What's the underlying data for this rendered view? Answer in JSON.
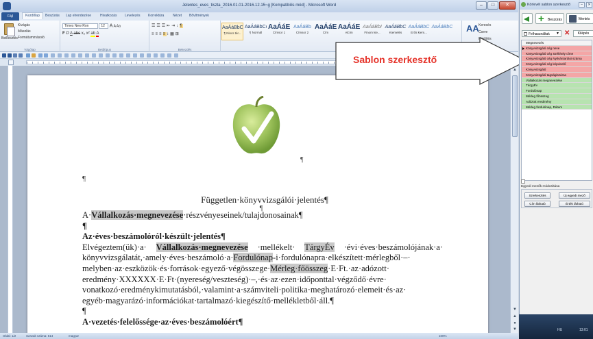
{
  "word": {
    "title": "Jelentes_eves_tiszta_2016.01.01-2016.12.15~g [Kompatibilis mód] - Microsoft Word",
    "tabs": [
      {
        "label": "Fájl"
      },
      {
        "label": "Kezdőlap"
      },
      {
        "label": "Beszúrás"
      },
      {
        "label": "Lap elrendezése"
      },
      {
        "label": "Hivatkozás"
      },
      {
        "label": "Levelezés"
      },
      {
        "label": "Korrektúra"
      },
      {
        "label": "Nézet"
      },
      {
        "label": "Bővítmények"
      }
    ],
    "clipboard": {
      "paste": "Beillesztés",
      "cut": "Kivágás",
      "copy": "Másolás",
      "format_painter": "Formátummásoló",
      "group": "Vágólap"
    },
    "font": {
      "name": "Times New Ron",
      "size": "12",
      "group": "Betűtípus"
    },
    "paragraph": {
      "group": "Bekezdés"
    },
    "styles": [
      {
        "sample": "AaÁáBbC",
        "name": "¶ Nincs tér..."
      },
      {
        "sample": "AaÁáBbCc",
        "name": "¶ Normál"
      },
      {
        "sample": "AaÁáE",
        "name": "Címsor 1"
      },
      {
        "sample": "AaÁáBb",
        "name": "Címsor 2"
      },
      {
        "sample": "AaÁáE",
        "name": "Cím"
      },
      {
        "sample": "AaÁáE",
        "name": "Alcím"
      },
      {
        "sample": "AaÁáBbI",
        "name": "Finom kie..."
      },
      {
        "sample": "AaÁáBbC",
        "name": "Kiemelés"
      },
      {
        "sample": "AaÁáBbC",
        "name": "Erős kiem..."
      },
      {
        "sample": "AaÁáBbC",
        "name": ""
      }
    ],
    "editing": {
      "find": "Keresés",
      "replace": "Csere",
      "select": "Kijelölés"
    },
    "change_styles": "AA",
    "status": {
      "page": "Oldal: 1/2",
      "words": "Szavak száma: 514",
      "lang": "magyar",
      "zoom": "100%"
    }
  },
  "document": {
    "pilcrow": "¶",
    "title": "Független·könyvvizsgálói·jelentés¶",
    "lines": [
      {
        "parts": [
          {
            "t": "A·"
          },
          {
            "t": "Vállalkozás·megnevezése",
            "f": true,
            "b": true
          },
          {
            "t": "·részvényeseinek/tulajdonosainak¶"
          }
        ]
      },
      {
        "parts": [
          {
            "t": "¶",
            "b": true
          }
        ]
      },
      {
        "parts": [
          {
            "t": "Az·éves·beszámolóról·készült·jelentés¶",
            "b": true
          }
        ]
      },
      {
        "just": true,
        "parts": [
          {
            "t": "Elvégeztem(ük)·a· "
          },
          {
            "t": "Vállalkozás·megnevezése",
            "f": true,
            "b": true
          },
          {
            "t": " ·mellékelt· "
          },
          {
            "t": "TárgyÉv",
            "f": true
          },
          {
            "t": " ·évi·éves·beszámolójának·a·"
          }
        ]
      },
      {
        "just": true,
        "parts": [
          {
            "t": "könyvvizsgálatát,·amely·éves·beszámoló·a·"
          },
          {
            "t": "Fordulónap",
            "f": true
          },
          {
            "t": "-i·fordulónapra·elkészített·mérlegből·–·"
          }
        ]
      },
      {
        "just": true,
        "parts": [
          {
            "t": "melyben·az·eszközök·és·források·egyező·végösszege·"
          },
          {
            "t": "Mérleg·főösszeg",
            "f": true
          },
          {
            "t": "·E·Ft.·az·adózott·"
          }
        ]
      },
      {
        "just": true,
        "parts": [
          {
            "t": "eredmény·XXXXXX·E·Ft·(nyereség/veszteség)·–,·és·az·ezen·időponttal·végződő·évre·"
          }
        ]
      },
      {
        "just": true,
        "parts": [
          {
            "t": "vonatkozó·eredménykimutatásból,·valamint·a·számviteli·politika·meghatározó·elemeit·és·az·"
          }
        ]
      },
      {
        "parts": [
          {
            "t": "egyéb·magyarázó·információkat·tartalmazó·kiegészítő·mellékletből·áll.¶"
          }
        ]
      },
      {
        "parts": [
          {
            "t": "¶"
          }
        ]
      },
      {
        "parts": [
          {
            "t": "A·vezetés·felelőssége·az·éves·beszámolóért¶",
            "b": true
          }
        ]
      }
    ]
  },
  "callout": {
    "text": "Sablon szerkesztő"
  },
  "panel": {
    "title": "Körlevél sablon szerkesztő",
    "insert": "Beszúrás",
    "save": "Mentés",
    "filter": "Felhasználtak",
    "close": "Kilépés",
    "list": [
      {
        "label": "Megnevezés",
        "kind": "header"
      },
      {
        "label": "Könyvvizsgáló cég neve",
        "kind": "red",
        "current": true
      },
      {
        "label": "Könyvvizsgáló cég Székhely címe",
        "kind": "red"
      },
      {
        "label": "Könyvvizsgáló cég Nyilvántartási száma",
        "kind": "red"
      },
      {
        "label": "Könyvvizsgáló cég képviselő",
        "kind": "red"
      },
      {
        "label": "Könyvvizsgáló",
        "kind": "red"
      },
      {
        "label": "Könyvvizsgáló tagságiszáma",
        "kind": "red"
      },
      {
        "label": "Vállalkozás megnevezése",
        "kind": "green"
      },
      {
        "label": "TárgyÉv",
        "kind": "green"
      },
      {
        "label": "Fordulónap",
        "kind": "green"
      },
      {
        "label": "Mérleg főösszeg",
        "kind": "green"
      },
      {
        "label": "Adózott eredmény",
        "kind": "green"
      },
      {
        "label": "Mérleg fordulónap, Dátum",
        "kind": "green"
      }
    ],
    "section": "Egyedi mezők módosítása",
    "btn_edit": "Szerkesztés",
    "btn_new": "Új egyedi mező",
    "btn_fields_visible": "Cím látható",
    "btn_values_visible": "Érték látható"
  },
  "taskbar": {
    "lang": "HU",
    "time": "13:01"
  }
}
